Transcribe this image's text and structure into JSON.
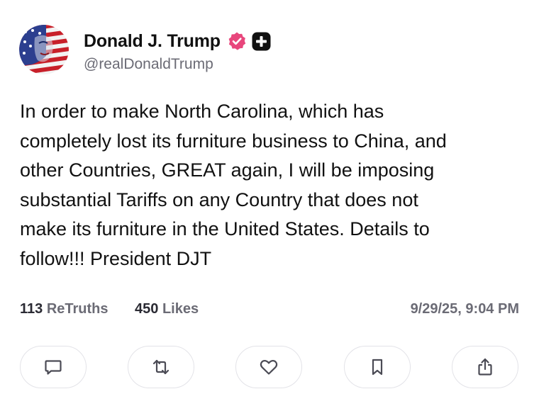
{
  "profile": {
    "display_name": "Donald J. Trump",
    "handle": "@realDonaldTrump",
    "verified_badge_icon": "verified-badge-icon",
    "plus_badge_icon": "plus-badge-icon",
    "verified_color": "#e8467c"
  },
  "post": {
    "text": "In order to make North Carolina, which has\ncompletely lost its furniture business to China, and\nother Countries, GREAT again, I will be imposing\nsubstantial Tariffs on any Country that does not\nmake its furniture in the United States. Details to\nfollow!!! President DJT"
  },
  "stats": {
    "retruths_count": "113",
    "retruths_label": "ReTruths",
    "likes_count": "450",
    "likes_label": "Likes",
    "timestamp": "9/29/25, 9:04 PM"
  },
  "actions": [
    {
      "name": "reply-button",
      "icon": "comment-icon"
    },
    {
      "name": "retruth-button",
      "icon": "repost-icon"
    },
    {
      "name": "like-button",
      "icon": "heart-icon"
    },
    {
      "name": "bookmark-button",
      "icon": "bookmark-icon"
    },
    {
      "name": "share-button",
      "icon": "share-icon"
    }
  ]
}
